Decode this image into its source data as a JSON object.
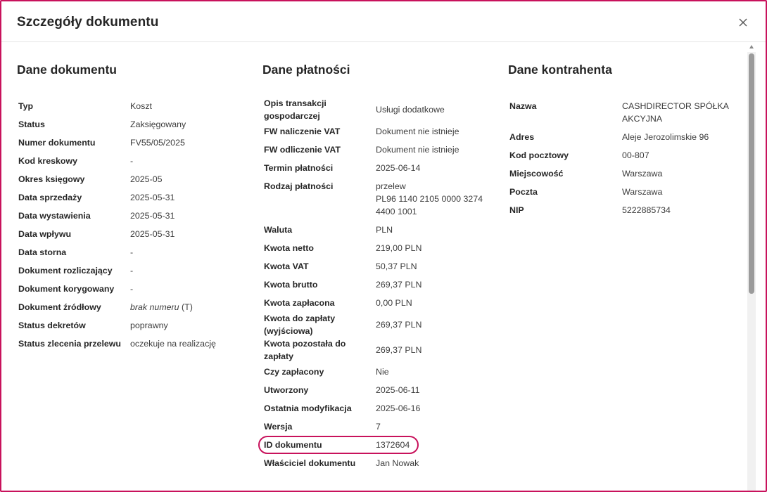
{
  "dialog": {
    "title": "Szczegóły dokumentu",
    "close_label": "×"
  },
  "document": {
    "title": "Dane dokumentu",
    "rows": [
      {
        "label": "Typ",
        "value": "Koszt"
      },
      {
        "label": "Status",
        "value": "Zaksięgowany"
      },
      {
        "label": "Numer dokumentu",
        "value": "FV55/05/2025"
      },
      {
        "label": "Kod kreskowy",
        "value": "-"
      },
      {
        "label": "Okres księgowy",
        "value": "2025-05"
      },
      {
        "label": "Data sprzedaży",
        "value": "2025-05-31"
      },
      {
        "label": "Data wystawienia",
        "value": "2025-05-31"
      },
      {
        "label": "Data wpływu",
        "value": "2025-05-31"
      },
      {
        "label": "Data storna",
        "value": "-"
      },
      {
        "label": "Dokument rozliczający",
        "value": "-"
      },
      {
        "label": "Dokument korygowany",
        "value": "-"
      },
      {
        "label": "Dokument źródłowy",
        "value_italic": "brak numeru",
        "value_suffix": " (T)"
      },
      {
        "label": "Status dekretów",
        "value": "poprawny"
      },
      {
        "label": "Status zlecenia przelewu",
        "value": "oczekuje na realizację"
      }
    ]
  },
  "payment": {
    "title": "Dane płatności",
    "rows": [
      {
        "label": "Opis transakcji gospodarczej",
        "value": "Usługi dodatkowe"
      },
      {
        "label": "FW naliczenie VAT",
        "value": "Dokument nie istnieje"
      },
      {
        "label": "FW odliczenie VAT",
        "value": "Dokument nie istnieje"
      },
      {
        "label": "Termin płatności",
        "value": "2025-06-14"
      },
      {
        "label": "Rodzaj płatności",
        "value_line1": "przelew",
        "value_line2": "PL96 1140 2105 0000 3274 4400 1001"
      },
      {
        "label": "Waluta",
        "value": "PLN"
      },
      {
        "label": "Kwota netto",
        "value": "219,00 PLN"
      },
      {
        "label": "Kwota VAT",
        "value": "50,37 PLN"
      },
      {
        "label": "Kwota brutto",
        "value": "269,37 PLN"
      },
      {
        "label": "Kwota zapłacona",
        "value": "0,00 PLN"
      },
      {
        "label": "Kwota do zapłaty (wyjściowa)",
        "value": "269,37 PLN"
      },
      {
        "label": "Kwota pozostała do zapłaty",
        "value": "269,37 PLN"
      },
      {
        "label": "Czy zapłacony",
        "value": "Nie"
      },
      {
        "label": "Utworzony",
        "value": "2025-06-11"
      },
      {
        "label": "Ostatnia modyfikacja",
        "value": "2025-06-16"
      },
      {
        "label": "Wersja",
        "value": "7"
      },
      {
        "label": "ID dokumentu",
        "value": "1372604"
      },
      {
        "label": "Właściciel dokumentu",
        "value": "Jan Nowak"
      }
    ]
  },
  "contractor": {
    "title": "Dane kontrahenta",
    "rows": [
      {
        "label": "Nazwa",
        "value": "CASHDIRECTOR SPÓŁKA AKCYJNA"
      },
      {
        "label": "Adres",
        "value": "Aleje Jerozolimskie 96"
      },
      {
        "label": "Kod pocztowy",
        "value": "00-807"
      },
      {
        "label": "Miejscowość",
        "value": "Warszawa"
      },
      {
        "label": "Poczta",
        "value": "Warszawa"
      },
      {
        "label": "NIP",
        "value": "5222885734"
      }
    ]
  },
  "colors": {
    "accent": "#c8125c",
    "text": "#262626",
    "scroll_thumb": "#9b9b9b"
  }
}
